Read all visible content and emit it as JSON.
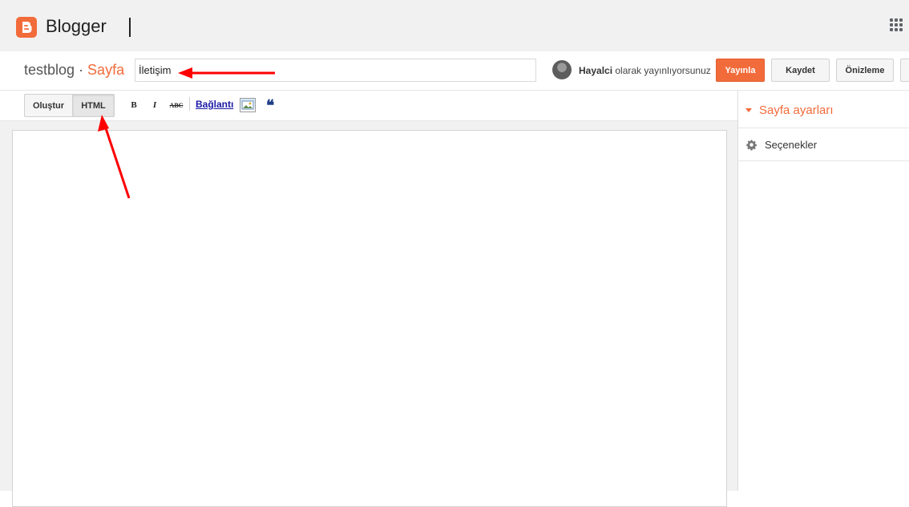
{
  "app": {
    "brand": "Blogger"
  },
  "header": {
    "blog_name": "testblog",
    "separator": " · ",
    "page_label": "Sayfa",
    "title_value": "İletişim",
    "author": "Hayalci",
    "publish_as_suffix": "olarak yayınlıyorsunuz"
  },
  "actions": {
    "publish": "Yayınla",
    "save": "Kaydet",
    "preview": "Önizleme",
    "close": ""
  },
  "editor_modes": {
    "compose": "Oluştur",
    "html": "HTML"
  },
  "formatting": {
    "bold": "B",
    "italic": "I",
    "strike": "ABC",
    "link": "Bağlantı",
    "quote": "❝"
  },
  "sidebar": {
    "title": "Sayfa ayarları",
    "options": "Seçenekler"
  },
  "colors": {
    "accent": "#f26b3a",
    "annotation": "#ff0000"
  },
  "icons": [
    "blogger-logo-icon",
    "apps-grid-icon",
    "avatar-icon",
    "image-icon",
    "gear-icon",
    "quote-icon"
  ]
}
